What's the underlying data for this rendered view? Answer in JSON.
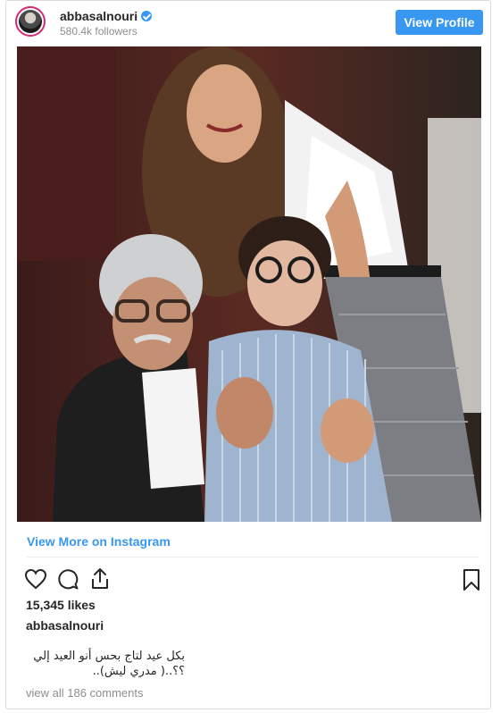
{
  "header": {
    "username": "abbasalnouri",
    "followers": "580.4k followers",
    "view_profile_label": "View Profile"
  },
  "photo": {
    "alt": "Photo of a man with grey hair and glasses, a woman with long brown hair, and a young boy with glasses"
  },
  "links": {
    "view_more": "View More on Instagram"
  },
  "actions": {
    "icons": [
      "heart-icon",
      "comment-icon",
      "share-icon",
      "bookmark-icon"
    ]
  },
  "stats": {
    "likes": "15,345 likes"
  },
  "post": {
    "author": "abbasalnouri",
    "caption_line1": "بكل عيد لتاج بحس أنو العيد إلي",
    "caption_line2": "؟؟..( مدري ليش)..",
    "view_comments": "view all 186 comments"
  },
  "colors": {
    "accent": "#3897f0",
    "border": "#dbdbdb",
    "muted": "#8e8e8e"
  }
}
